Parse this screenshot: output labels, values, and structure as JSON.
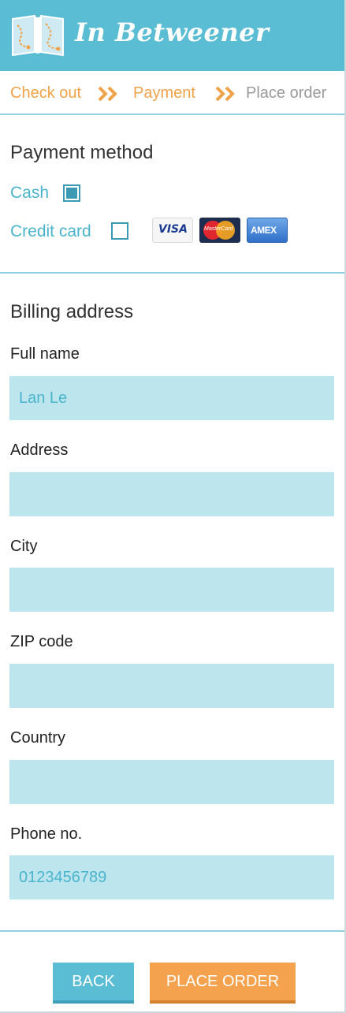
{
  "app": {
    "title": "In Betweener"
  },
  "breadcrumb": {
    "steps": [
      {
        "label": "Check out",
        "state": "active"
      },
      {
        "label": "Payment",
        "state": "active"
      },
      {
        "label": "Place order",
        "state": "inactive"
      }
    ]
  },
  "payment_method": {
    "title": "Payment method",
    "options": [
      {
        "label": "Cash",
        "checked": true
      },
      {
        "label": "Credit card",
        "checked": false
      }
    ],
    "cards": [
      "VISA",
      "MasterCard",
      "AMEX"
    ]
  },
  "billing": {
    "title": "Billing address",
    "fields": [
      {
        "label": "Full name",
        "value": "Lan Le"
      },
      {
        "label": "Address",
        "value": ""
      },
      {
        "label": "City",
        "value": ""
      },
      {
        "label": "ZIP code",
        "value": ""
      },
      {
        "label": "Country",
        "value": ""
      },
      {
        "label": "Phone no.",
        "value": "0123456789"
      }
    ]
  },
  "actions": {
    "back_label": "BACK",
    "place_order_label": "PLACE ORDER"
  },
  "colors": {
    "brand": "#5bbdd4",
    "accent": "#f4a24e",
    "input_bg": "#bde5ee",
    "link": "#4ab4cc"
  }
}
